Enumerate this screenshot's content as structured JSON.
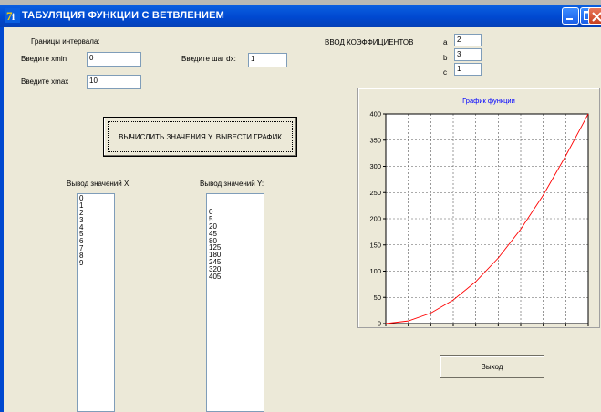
{
  "window": {
    "title": "ТАБУЛЯЦИЯ ФУНКЦИИ С ВЕТВЛЕНИЕМ"
  },
  "interval": {
    "heading": "Границы интервала:",
    "xmin_label": "Введите xmin",
    "xmin_value": "0",
    "xmax_label": "Введите xmax",
    "xmax_value": "10",
    "step_label": "Введите шаг dx:",
    "step_value": "1"
  },
  "coefficients": {
    "heading": "ВВОД КОЭФФИЦИЕНТОВ",
    "a_label": "a",
    "a_value": "2",
    "b_label": "b",
    "b_value": "3",
    "c_label": "c",
    "c_value": "1"
  },
  "calc_button": {
    "label": "ВЫЧИСЛИТЬ ЗНАЧЕНИЯ Y. ВЫВЕСТИ ГРАФИК"
  },
  "output_x": {
    "label": "Вывод значений X:",
    "items": [
      "0",
      "1",
      "2",
      "3",
      "4",
      "5",
      "6",
      "7",
      "8",
      "9"
    ]
  },
  "output_y": {
    "label": "Вывод значений Y:",
    "items": [
      "0",
      "5",
      "20",
      "45",
      "80",
      "125",
      "180",
      "245",
      "320",
      "405"
    ]
  },
  "exit_button": {
    "label": "Выход"
  },
  "colors": {
    "titlebar": "#0048d0",
    "window_bg": "#ece9d8",
    "line": "#ff0000",
    "chart_title": "#0000ff"
  },
  "chart_data": {
    "type": "line",
    "title": "График функции",
    "x": [
      0,
      1,
      2,
      3,
      4,
      5,
      6,
      7,
      8,
      9
    ],
    "series": [
      {
        "values": [
          0,
          5,
          20,
          45,
          80,
          125,
          180,
          245,
          320,
          405
        ]
      }
    ],
    "xlim": [
      0,
      9
    ],
    "ylim": [
      0,
      400
    ],
    "x_ticks": [
      "0",
      "1",
      "2",
      "3",
      "4",
      "5",
      "6",
      "7",
      "8",
      "9"
    ],
    "y_ticks": [
      "0",
      "50",
      "100",
      "150",
      "200",
      "250",
      "300",
      "350",
      "400"
    ],
    "grid": true
  }
}
